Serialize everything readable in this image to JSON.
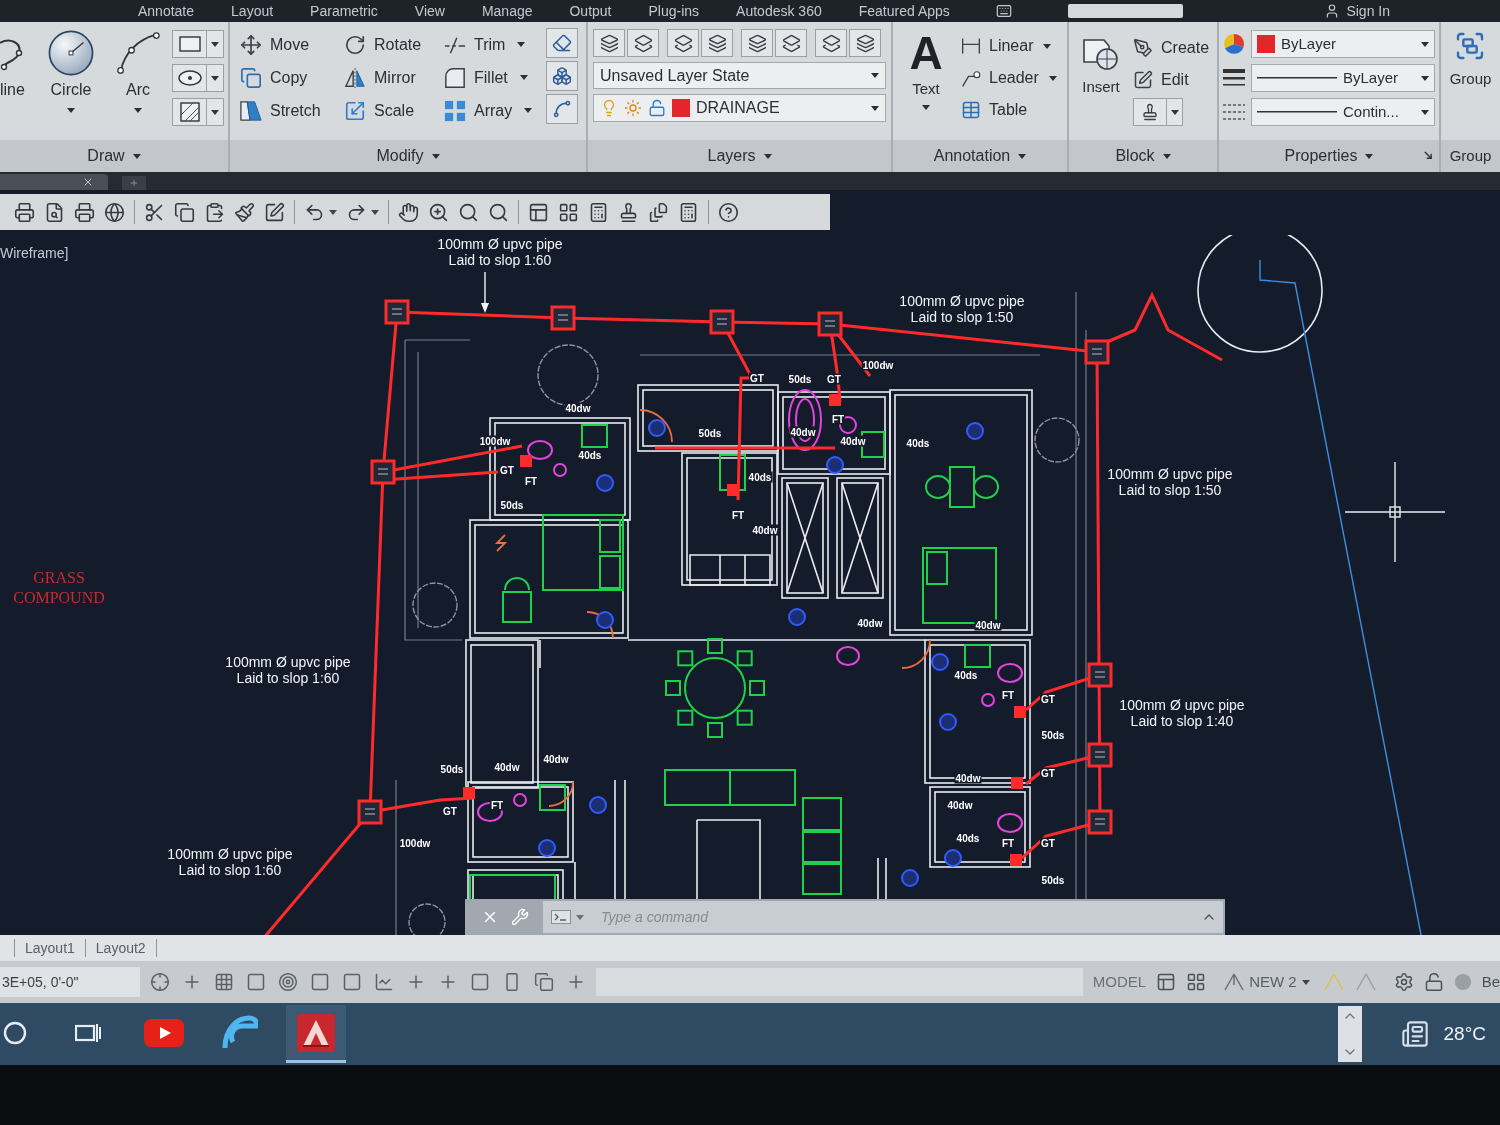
{
  "menu_tabs": [
    "Annotate",
    "Layout",
    "Parametric",
    "View",
    "Manage",
    "Output",
    "Plug-ins",
    "Autodesk 360",
    "Featured Apps"
  ],
  "account": {
    "label": "Sign In"
  },
  "ribbon": {
    "draw": {
      "title": "Draw",
      "tools": [
        {
          "label": "line",
          "kind": "polyline",
          "has_menu": false
        },
        {
          "label": "Circle",
          "kind": "circle",
          "has_menu": true
        },
        {
          "label": "Arc",
          "kind": "arc",
          "has_menu": true
        }
      ]
    },
    "modify": {
      "title": "Modify",
      "tools": [
        {
          "label": "Move",
          "kind": "move",
          "has_menu": false
        },
        {
          "label": "Rotate",
          "kind": "rotate",
          "has_menu": false
        },
        {
          "label": "Trim",
          "kind": "trim",
          "has_menu": true
        },
        {
          "label": "Copy",
          "kind": "copy",
          "has_menu": false
        },
        {
          "label": "Mirror",
          "kind": "mirror",
          "has_menu": false
        },
        {
          "label": "Fillet",
          "kind": "fillet",
          "has_menu": true
        },
        {
          "label": "Stretch",
          "kind": "stretch",
          "has_menu": false
        },
        {
          "label": "Scale",
          "kind": "scale",
          "has_menu": false
        },
        {
          "label": "Array",
          "kind": "array",
          "has_menu": true
        }
      ]
    },
    "layers": {
      "title": "Layers",
      "layer_state": "Unsaved Layer State",
      "current_layer": {
        "name": "DRAINAGE",
        "color": "#e3262b"
      }
    },
    "annotation": {
      "title": "Annotation",
      "text_tool": {
        "glyph": "A",
        "label": "Text",
        "has_menu": true
      },
      "tools": [
        {
          "label": "Linear",
          "kind": "linear",
          "has_menu": true
        },
        {
          "label": "Leader",
          "kind": "leader",
          "has_menu": true
        },
        {
          "label": "Table",
          "kind": "table",
          "has_menu": false
        }
      ]
    },
    "block": {
      "title": "Block",
      "insert": "Insert",
      "tools": [
        {
          "label": "Create",
          "kind": "create"
        },
        {
          "label": "Edit",
          "kind": "edit"
        }
      ]
    },
    "properties": {
      "title": "Properties",
      "color": {
        "value": "ByLayer",
        "color": "#e3262b"
      },
      "lineweight": "ByLayer",
      "linetype": "Contin..."
    },
    "groups": {
      "title": "Group",
      "tool": "Group"
    }
  },
  "drawing": {
    "view_label": "Wireframe]",
    "pipe_notes": [
      {
        "size": "100mm Ø upvc pipe",
        "slope": "Laid to slop 1:60"
      },
      {
        "size": "100mm Ø upvc pipe",
        "slope": "Laid to slop 1:50"
      },
      {
        "size": "100mm Ø upvc pipe",
        "slope": "Laid to slop 1:50"
      },
      {
        "size": "100mm Ø upvc pipe",
        "slope": "Laid to slop 1:60"
      },
      {
        "size": "100mm Ø upvc pipe",
        "slope": "Laid to slop 1:40"
      },
      {
        "size": "100mm Ø upvc pipe",
        "slope": "Laid to slop 1:60"
      }
    ],
    "area_label": "GRASS COMPOUND",
    "fixture_labels": [
      "100dw",
      "GT",
      "50ds",
      "GT",
      "40dw",
      "FT",
      "100dw",
      "50ds",
      "40dw",
      "40dw",
      "40ds",
      "40ds",
      "GT",
      "FT",
      "40ds",
      "50ds",
      "FT",
      "40dw",
      "40dw",
      "40dw",
      "40ds",
      "FT",
      "GT",
      "50ds",
      "50ds",
      "40dw",
      "40dw",
      "40dw",
      "GT",
      "GT",
      "FT",
      "40dw",
      "100dw",
      "40ds",
      "FT",
      "GT",
      "50ds"
    ]
  },
  "layout_tabs": [
    "Layout1",
    "Layout2"
  ],
  "command_line": {
    "placeholder": "Type a command"
  },
  "status_bar": {
    "coordinates": "3E+05, 0'-0\"",
    "space": "MODEL",
    "workspace": "NEW 2",
    "cut_label": "Be"
  },
  "taskbar": {
    "apps": [
      {
        "kind": "cortana",
        "running": false
      },
      {
        "kind": "task_view",
        "running": false
      },
      {
        "kind": "youtube",
        "running": false
      },
      {
        "kind": "browser",
        "running": false
      },
      {
        "kind": "autocad",
        "running": true
      }
    ],
    "weather": "28°C"
  }
}
